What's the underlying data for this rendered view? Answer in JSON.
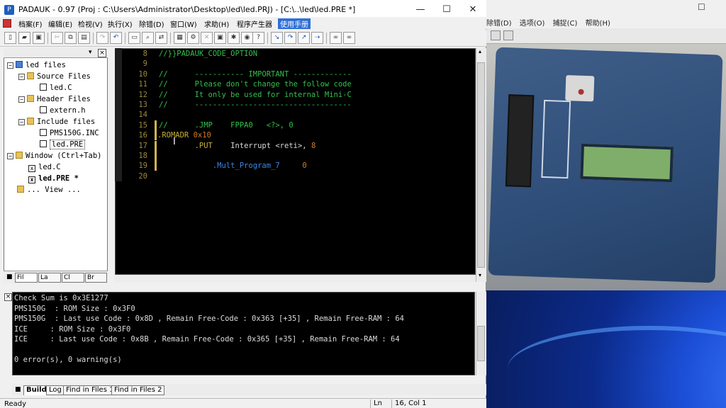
{
  "window": {
    "title": "PADAUK - 0.97 (Proj : C:\\Users\\Administrator\\Desktop\\led\\led.PRJ) - [C:\\..\\led\\led.PRE *]"
  },
  "menu": [
    "档案(F)",
    "编辑(E)",
    "检视(V)",
    "执行(X)",
    "除错(D)",
    "窗口(W)",
    "求助(H)",
    "程序产生器",
    "使用手册"
  ],
  "background_window": {
    "menu": [
      "除错(D)",
      "选项(O)",
      "捕捉(C)",
      "帮助(H)"
    ]
  },
  "tree": {
    "root": "led files",
    "source_files": "Source Files",
    "source_items": [
      "led.C"
    ],
    "header_files": "Header Files",
    "header_items": [
      "extern.h"
    ],
    "include_files": "Include files",
    "include_items": [
      "PMS150G.INC",
      "led.PRE"
    ],
    "window_group": "Window (Ctrl+Tab)",
    "window_items": [
      "led.C",
      "led.PRE *"
    ],
    "view": "... View ...",
    "tabs": [
      "Fil",
      "La",
      "Cl",
      "Br"
    ]
  },
  "code_lines": [
    {
      "n": "8",
      "t": "//}}PADAUK_CODE_OPTION"
    },
    {
      "n": "9",
      "t": ""
    },
    {
      "n": "10",
      "t": "//      ----------- IMPORTANT -------------"
    },
    {
      "n": "11",
      "t": "//      Please don't change the follow code"
    },
    {
      "n": "12",
      "t": "//      It only be used for internal Mini-C"
    },
    {
      "n": "13",
      "t": "//      -----------------------------------"
    },
    {
      "n": "14",
      "t": ""
    },
    {
      "n": "15",
      "t": "//      .JMP    FPPA0   <?>, 0"
    },
    {
      "n": "16",
      "t_dir": ".ROMADR",
      "t_num": "0x10"
    },
    {
      "n": "17",
      "t_dir": "        .PUT",
      "t_plain": "    Interrupt <reti>,",
      "t_num": "8"
    },
    {
      "n": "18",
      "t": ""
    },
    {
      "n": "19",
      "t_dir2": "            .Mult_Program_7",
      "t_num": "0"
    },
    {
      "n": "20",
      "t": ""
    }
  ],
  "output": [
    "Check Sum is 0x3E1277",
    "PMS150G  : ROM Size : 0x3F0",
    "PMS150G  : Last use Code : 0x8D , Remain Free-Code : 0x363 [+35] , Remain Free-RAM : 64",
    "ICE     : ROM Size : 0x3F0",
    "ICE     : Last use Code : 0x8B , Remain Free-Code : 0x365 [+35] , Remain Free-RAM : 64",
    "",
    "0 error(s), 0 warning(s)"
  ],
  "output_tabs": [
    "Build",
    "Log",
    "Find in Files 1",
    "Find in Files 2"
  ],
  "status": {
    "ready": "Ready",
    "ln_label": "Ln",
    "position": "16, Col 1"
  },
  "colors": {
    "editor_bg": "#000000",
    "comment": "#33c04c",
    "directive": "#c7b03a",
    "number": "#d07b2a",
    "menu_highlight": "#2f6fd6"
  }
}
